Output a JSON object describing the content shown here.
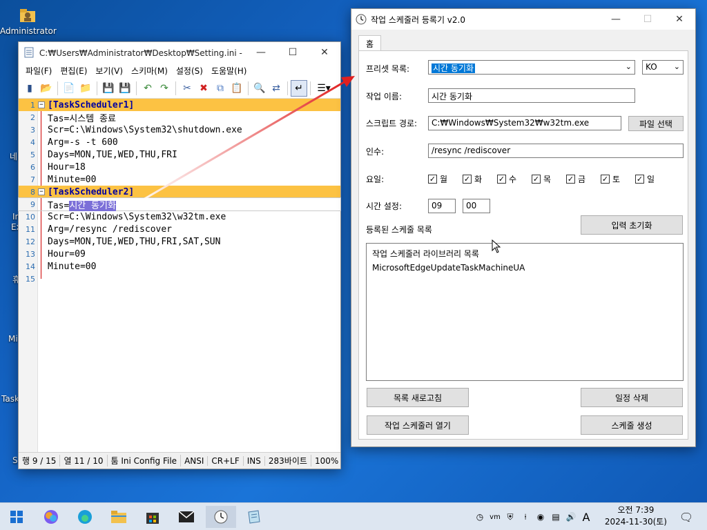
{
  "desktop": {
    "icons": [
      {
        "label": "Administrator"
      }
    ],
    "partial_labels": [
      "네",
      "In",
      "Ex",
      "휴",
      "Mi",
      "Task",
      "S"
    ]
  },
  "notepad": {
    "title": "C:₩Users₩Administrator₩Desktop₩Setting.ini - 메모...",
    "menu": [
      "파일(F)",
      "편집(E)",
      "보기(V)",
      "스키마(M)",
      "설정(S)",
      "도움말(H)"
    ],
    "lines": [
      {
        "n": "1",
        "text": "[TaskScheduler1]",
        "type": "section"
      },
      {
        "n": "2",
        "text": "Tas=시스템 종료",
        "type": "kv"
      },
      {
        "n": "3",
        "text": "Scr=C:\\Windows\\System32\\shutdown.exe",
        "type": "kv"
      },
      {
        "n": "4",
        "text": "Arg=-s -t 600",
        "type": "kv"
      },
      {
        "n": "5",
        "text": "Days=MON,TUE,WED,THU,FRI",
        "type": "kv"
      },
      {
        "n": "6",
        "text": "Hour=18",
        "type": "kv"
      },
      {
        "n": "7",
        "text": "Minute=00",
        "type": "kv"
      },
      {
        "n": "8",
        "text": "[TaskScheduler2]",
        "type": "section"
      },
      {
        "n": "9",
        "text_prefix": "Tas=",
        "text_selected": "시간 동기화",
        "type": "current"
      },
      {
        "n": "10",
        "text": "Scr=C:\\Windows\\System32\\w32tm.exe",
        "type": "kv"
      },
      {
        "n": "11",
        "text": "Arg=/resync /rediscover",
        "type": "kv"
      },
      {
        "n": "12",
        "text": "Days=MON,TUE,WED,THU,FRI,SAT,SUN",
        "type": "kv"
      },
      {
        "n": "13",
        "text": "Hour=09",
        "type": "kv"
      },
      {
        "n": "14",
        "text": "Minute=00",
        "type": "kv"
      },
      {
        "n": "15",
        "text": "",
        "type": "kv"
      }
    ],
    "status": {
      "position": "행 9 / 15",
      "column": "열 11 / 10",
      "scheme": "툼 Ini Config File",
      "encoding": "ANSI",
      "eol": "CR+LF",
      "mode": "INS",
      "size": "283바이트",
      "zoom": "100%"
    }
  },
  "scheduler": {
    "title": "작업 스케줄러 등록기 v2.0",
    "tab": "홈",
    "preset_label": "프리셋 목록:",
    "preset_value": "시간 동기화",
    "lang_value": "KO",
    "task_name_label": "작업 이름:",
    "task_name_value": "시간 동기화",
    "script_label": "스크립트 경로:",
    "script_value": "C:₩Windows₩System32₩w32tm.exe",
    "file_select_button": "파일 선택",
    "args_label": "인수:",
    "args_value": "/resync /rediscover",
    "days_label": "요일:",
    "days": [
      {
        "label": "월",
        "checked": true
      },
      {
        "label": "화",
        "checked": true
      },
      {
        "label": "수",
        "checked": true
      },
      {
        "label": "목",
        "checked": true
      },
      {
        "label": "금",
        "checked": true
      },
      {
        "label": "토",
        "checked": true
      },
      {
        "label": "일",
        "checked": true
      }
    ],
    "time_label": "시간 설정:",
    "hour_value": "09",
    "minute_value": "00",
    "registered_label": "등록된 스케줄 목록",
    "reset_button": "입력 초기화",
    "list_items": [
      "작업 스케줄러 라이브러리 목록",
      "MicrosoftEdgeUpdateTaskMachineUA"
    ],
    "refresh_button": "목록 새로고침",
    "delete_button": "일정 삭제",
    "open_button": "작업 스케줄러 열기",
    "create_button": "스케줄 생성"
  },
  "taskbar": {
    "tray_lang": "A",
    "clock_time": "오전 7:39",
    "clock_date": "2024-11-30(토)"
  },
  "colors": {
    "section_highlight": "#fcc243",
    "selection": "#7b6fd8",
    "arrow": "#e02020"
  }
}
